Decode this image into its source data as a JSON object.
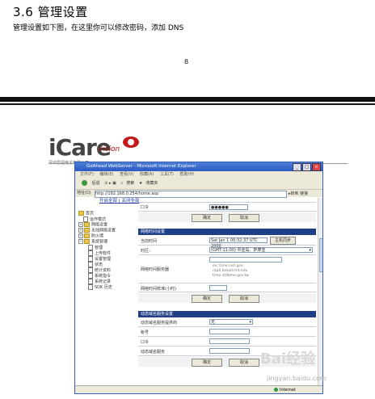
{
  "doc": {
    "heading": "3.6 管理设置",
    "intro": "管理设置如下图，在这里你可以修改密码，添加 DNS",
    "page_number": "8"
  },
  "logo": {
    "brand": "iCare",
    "sub_brand": "vision",
    "tagline": "深圳爱视电子有限公司"
  },
  "browser": {
    "title": "GoAhead WebServer - Microsoft Internet Explorer",
    "menu": [
      "文件(F)",
      "编辑(E)",
      "查看(V)",
      "收藏(A)",
      "工具(T)",
      "帮助(H)"
    ],
    "toolbar": [
      "后退",
      "搜索",
      "收藏夹"
    ],
    "address_label": "地址(D)",
    "address": "http://192.168.0.254/home.asp",
    "go_label": "转到",
    "links_label": "链接",
    "status_text": "Internet"
  },
  "tabs": [
    "开启全部",
    "关闭全部"
  ],
  "sidebar": {
    "items": [
      {
        "label": "首页",
        "type": "root"
      },
      {
        "label": "运作模式",
        "type": "page"
      },
      {
        "label": "网络设置",
        "type": "folder"
      },
      {
        "label": "无线网络设置",
        "type": "folder"
      },
      {
        "label": "防火墙",
        "type": "folder"
      },
      {
        "label": "系统管理",
        "type": "folder-open"
      },
      {
        "label": "管理",
        "type": "page"
      },
      {
        "label": "上传软件",
        "type": "page"
      },
      {
        "label": "设置管理",
        "type": "page"
      },
      {
        "label": "状态",
        "type": "page"
      },
      {
        "label": "统计资料",
        "type": "page"
      },
      {
        "label": "系统指令",
        "type": "page"
      },
      {
        "label": "系统记录",
        "type": "page"
      },
      {
        "label": "SDK 历史",
        "type": "page"
      }
    ]
  },
  "account": {
    "password_label": "口令",
    "password_value": "●●●●●",
    "apply_label": "确定",
    "cancel_label": "取消"
  },
  "ntp": {
    "header": "网络时间设置",
    "current_time_label": "当前时间",
    "current_time_value": "Sat Jan 1 00:32:37 UTC 2000",
    "sync_button": "主机同步",
    "timezone_label": "时区：",
    "timezone_value": "(GMT-11:00) 中途岛、萨摩亚",
    "server_label": "网络时间服务器",
    "server_examples": [
      "ex: time.nist.gov",
      "ntp0.broad.mit.edu",
      "time.stdtime.gov.tw"
    ],
    "sync_interval_label": "网络时间校准(小时)",
    "apply_label": "确定",
    "cancel_label": "取消"
  },
  "ddns": {
    "header": "动态域名服务设置",
    "provider_label": "动态域名服务提供商",
    "provider_value": "无",
    "account_label": "帐号",
    "password_label": "口令",
    "domain_label": "动态域名服务",
    "apply_label": "确定",
    "cancel_label": "取消"
  },
  "watermark": {
    "main": "Bai经验",
    "url": "jingyan.baidu.com"
  }
}
